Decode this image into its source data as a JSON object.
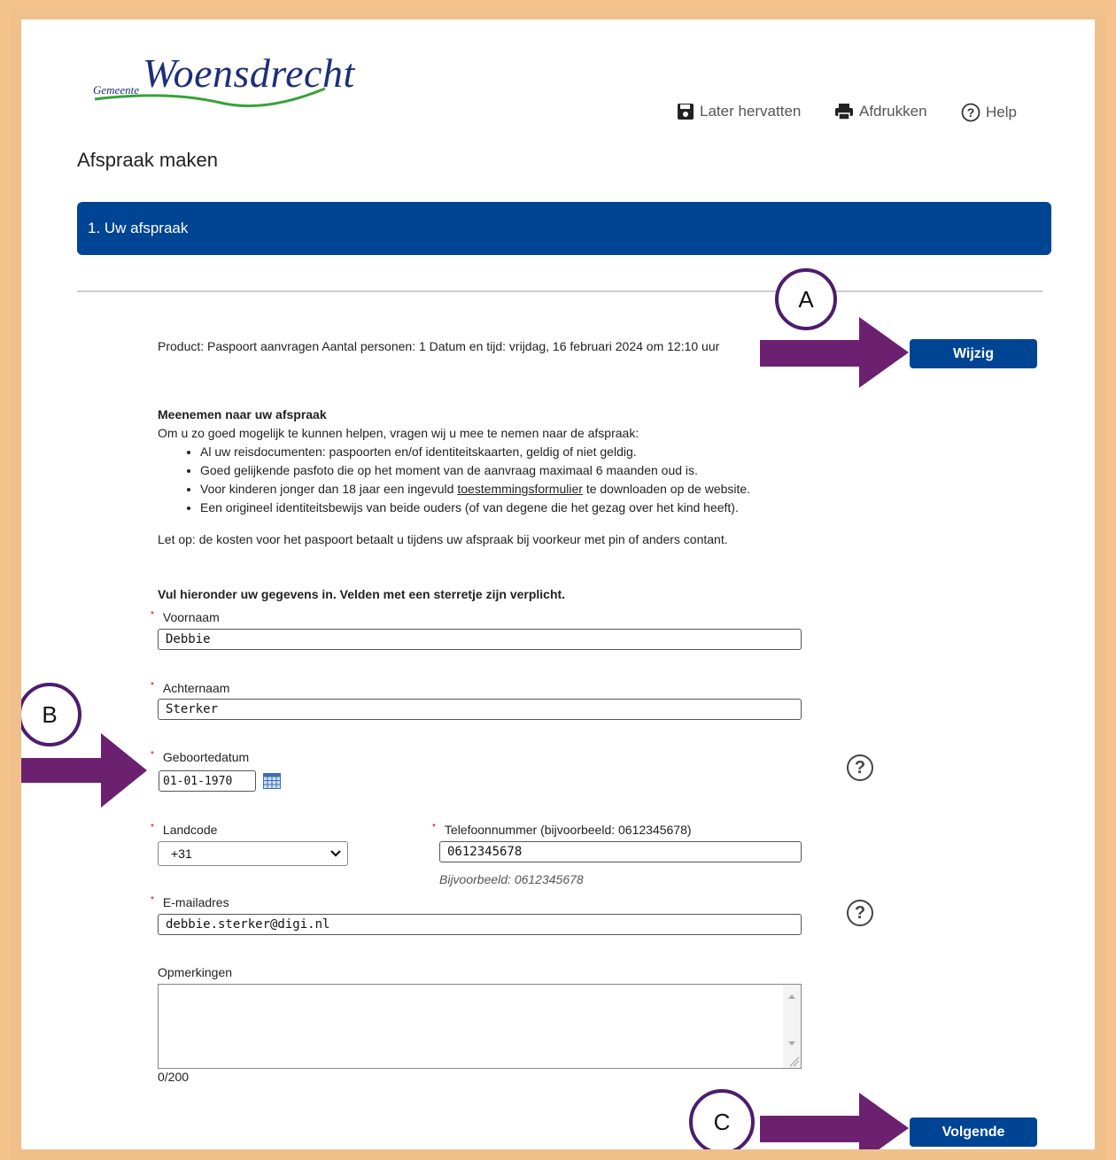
{
  "header": {
    "logo_prefix": "Gemeente",
    "logo_name": "Woensdrecht",
    "actions": {
      "later": "Later hervatten",
      "print": "Afdrukken",
      "help": "Help"
    }
  },
  "page_title": "Afspraak maken",
  "step": {
    "label": "1. Uw afspraak"
  },
  "summary": {
    "text": "Product: Paspoort aanvragen Aantal personen: 1 Datum en tijd: vrijdag, 16 februari 2024 om 12:10 uur",
    "change_button": "Wijzig"
  },
  "info": {
    "heading": "Meenemen naar uw afspraak",
    "intro": "Om u zo goed mogelijk te kunnen helpen, vragen wij u mee te nemen naar de afspraak:",
    "item1": "Al uw reisdocumenten: paspoorten en/of identiteitskaarten, geldig of niet geldig.",
    "item2": "Goed gelijkende pasfoto die op het moment van de aanvraag maximaal 6 maanden oud is.",
    "item3_before": "Voor kinderen jonger dan 18 jaar een ingevuld ",
    "item3_link": "toestemmingsformulier",
    "item3_after": " te downloaden op de website.",
    "item4": "Een origineel identiteitsbewijs van beide ouders (of van degene die het gezag over het kind heeft).",
    "note": "Let op: de kosten voor het paspoort betaalt u tijdens uw afspraak bij voorkeur met pin of anders contant."
  },
  "form": {
    "instructions": "Vul hieronder uw gegevens in. Velden met een sterretje zijn verplicht.",
    "required_mark": "*",
    "first_name": {
      "label": "Voornaam",
      "value": "Debbie"
    },
    "last_name": {
      "label": "Achternaam",
      "value": "Sterker"
    },
    "birthdate": {
      "label": "Geboortedatum",
      "value": "01-01-1970"
    },
    "country_code": {
      "label": "Landcode",
      "value": "+31"
    },
    "phone": {
      "label": "Telefoonnummer (bijvoorbeeld: 0612345678)",
      "value": "0612345678",
      "hint": "Bijvoorbeeld: 0612345678"
    },
    "email": {
      "label": "E-mailadres",
      "value": "debbie.sterker@digi.nl"
    },
    "remarks": {
      "label": "Opmerkingen",
      "value": "",
      "counter": "0/200"
    },
    "next_button": "Volgende"
  },
  "annotations": {
    "a": "A",
    "b": "B",
    "c": "C",
    "arrow_color": "#6b2070"
  },
  "colors": {
    "primary": "#004494",
    "frame": "#f0c08a"
  }
}
